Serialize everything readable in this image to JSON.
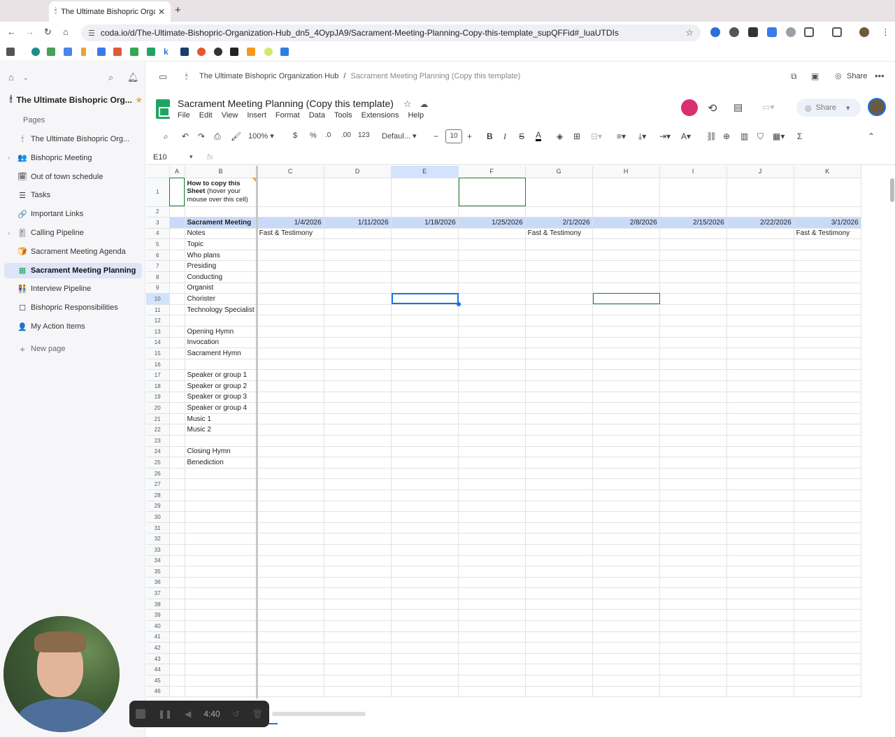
{
  "browser": {
    "tab_title": "The Ultimate Bishopric Organ",
    "url": "coda.io/d/The-Ultimate-Bishopric-Organization-Hub_dn5_4OypJA9/Sacrament-Meeting-Planning-Copy-this-template_supQFFid#_luaUTDIs"
  },
  "coda": {
    "doc_title": "The Ultimate Bishopric Org...",
    "pages_heading": "Pages",
    "pages": [
      {
        "label": "The Ultimate Bishopric Org...",
        "icon": "🕯",
        "has_children": false
      },
      {
        "label": "Bishopric Meeting",
        "icon": "👥",
        "has_children": true
      },
      {
        "label": "Out of town schedule",
        "icon": "🗓",
        "has_children": false
      },
      {
        "label": "Tasks",
        "icon": "☰",
        "has_children": false
      },
      {
        "label": "Important Links",
        "icon": "🔗",
        "has_children": false
      },
      {
        "label": "Calling Pipeline",
        "icon": "🎚",
        "has_children": true
      },
      {
        "label": "Sacrament Meeting Agenda",
        "icon": "🍞",
        "has_children": false
      },
      {
        "label": "Sacrament Meeting Planning",
        "icon": "▦",
        "has_children": false,
        "active": true
      },
      {
        "label": "Interview Pipeline",
        "icon": "👫",
        "has_children": false
      },
      {
        "label": "Bishopric Responsibilities",
        "icon": "☐",
        "has_children": false
      },
      {
        "label": "My Action Items",
        "icon": "👤",
        "has_children": false
      }
    ],
    "new_page": "New page",
    "breadcrumb_parent": "The Ultimate Bishopric Organization Hub",
    "breadcrumb_sep": "/",
    "breadcrumb_current": "Sacrament Meeting Planning (Copy this template)",
    "share": "Share"
  },
  "sheet": {
    "title": "Sacrament Meeting Planning (Copy this template)",
    "menus": [
      "File",
      "Edit",
      "View",
      "Insert",
      "Format",
      "Data",
      "Tools",
      "Extensions",
      "Help"
    ],
    "share": "Share",
    "zoom": "100%",
    "currency": "$",
    "percent": "%",
    "dec_less": ".0",
    "dec_more": ".00",
    "number_format": "123",
    "font": "Defaul...",
    "font_size": "10",
    "name_box": "E10",
    "fx": "fx",
    "columns": [
      "A",
      "B",
      "C",
      "D",
      "E",
      "F",
      "G",
      "H",
      "I",
      "J",
      "K"
    ],
    "copy_note_bold": "How to copy this Sheet",
    "copy_note_rest": "(hover your mouse over this cell)",
    "header_label": "Sacrament Meeting",
    "dates": [
      "1/4/2026",
      "1/11/2026",
      "1/18/2026",
      "1/25/2026",
      "2/1/2026",
      "2/8/2026",
      "2/15/2026",
      "2/22/2026",
      "3/1/2026"
    ],
    "notes_label": "Notes",
    "notes": [
      "Fast & Testimony",
      "",
      "",
      "",
      "Fast & Testimony",
      "",
      "",
      "",
      "Fast & Testimony"
    ],
    "rows": {
      "5": "Topic",
      "6": "Who plans",
      "7": "Presiding",
      "8": "Conducting",
      "9": "Organist",
      "10": "Chorister",
      "11": "Technology Specialist",
      "13": "Opening Hymn",
      "14": "Invocation",
      "15": "Sacrament Hymn",
      "17": "Speaker or group 1",
      "18": "Speaker or group 2",
      "19": "Speaker or group 3",
      "20": "Speaker or group 4",
      "21": "Music 1",
      "22": "Music 2",
      "24": "Closing Hymn",
      "25": "Benediction"
    },
    "row_count": 46
  },
  "recorder": {
    "time": "4:40"
  },
  "colors": {
    "accent": "#1a73e8",
    "sheets_green": "#1fa463",
    "header_blue": "#c9daf8",
    "selection_green": "#188038"
  }
}
